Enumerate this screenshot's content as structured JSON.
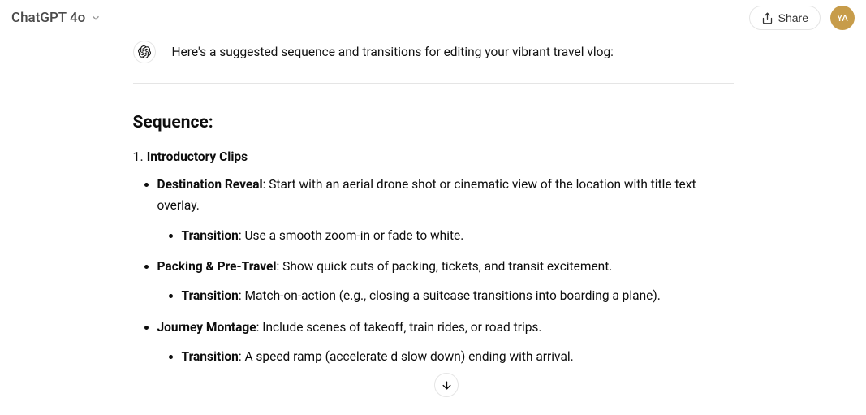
{
  "header": {
    "model_name": "ChatGPT 4o",
    "share_label": "Share",
    "avatar_initials": "YA"
  },
  "message": {
    "intro": "Here's a suggested sequence and transitions for editing your vibrant travel vlog:"
  },
  "section": {
    "title": "Sequence:",
    "item1": {
      "heading": "Introductory Clips",
      "b1_label": "Destination Reveal",
      "b1_desc": ": Start with an aerial drone shot or cinematic view of the location with title text overlay.",
      "b1_t_label": "Transition",
      "b1_t_desc": ": Use a smooth zoom-in or fade to white.",
      "b2_label": "Packing & Pre-Travel",
      "b2_desc": ": Show quick cuts of packing, tickets, and transit excitement.",
      "b2_t_label": "Transition",
      "b2_t_desc": ": Match-on-action (e.g., closing a suitcase transitions into boarding a plane).",
      "b3_label": "Journey Montage",
      "b3_desc": ": Include scenes of takeoff, train rides, or road trips.",
      "b3_t_label": "Transition",
      "b3_t_desc_a": ": A speed ramp (accelerate ",
      "b3_t_desc_b": "d slow down) ending with arrival."
    }
  }
}
